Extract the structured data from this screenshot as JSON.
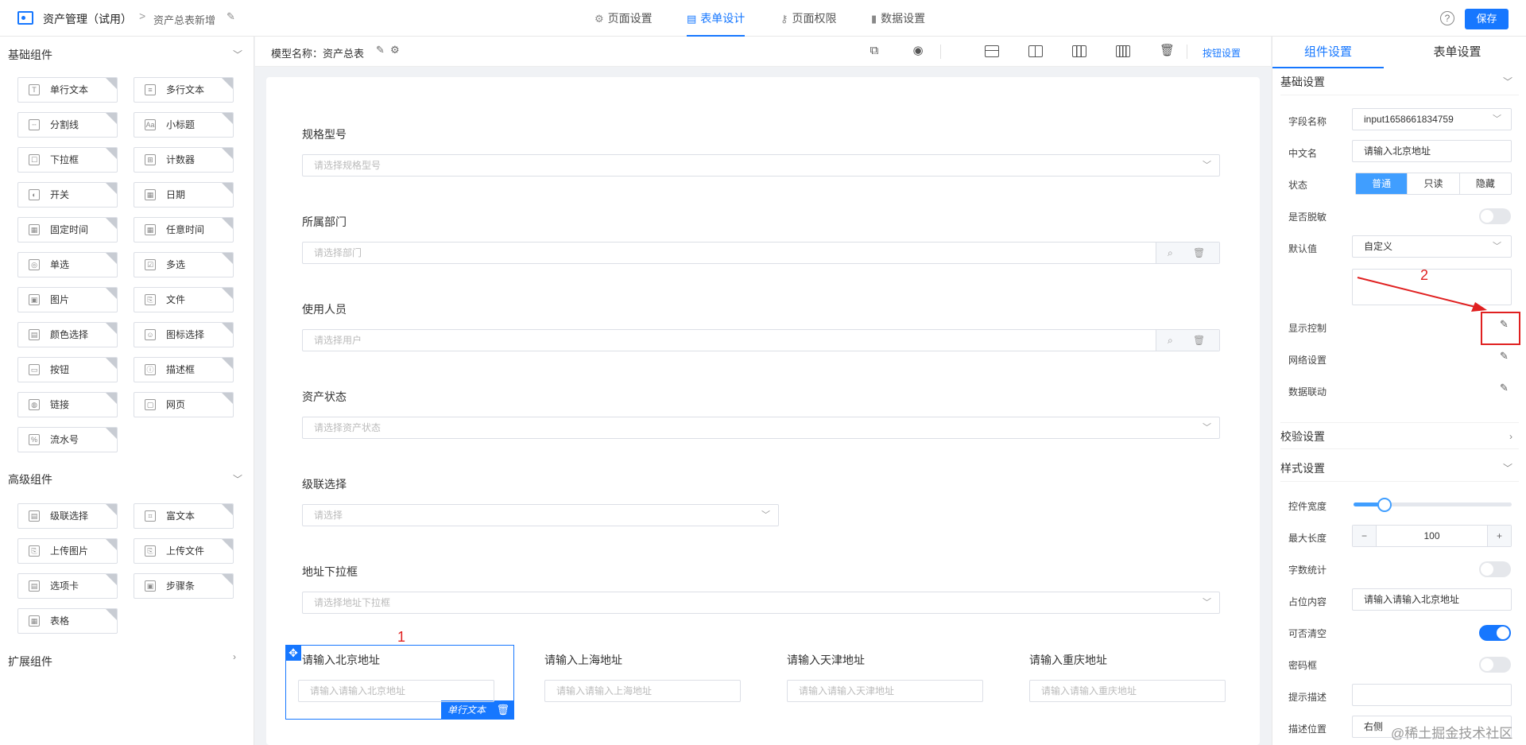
{
  "header": {
    "app_title": "资产管理（试用）",
    "breadcrumb_sep": ">",
    "page_name": "资产总表新增",
    "nav": [
      {
        "label": "页面设置",
        "icon": "gear-icon"
      },
      {
        "label": "表单设计",
        "icon": "document-icon"
      },
      {
        "label": "页面权限",
        "icon": "key-icon"
      },
      {
        "label": "数据设置",
        "icon": "bar-chart-icon"
      }
    ],
    "save_label": "保存"
  },
  "palette": {
    "basic_title": "基础组件",
    "basic_items": [
      "单行文本",
      "多行文本",
      "分割线",
      "小标题",
      "下拉框",
      "计数器",
      "开关",
      "日期",
      "固定时间",
      "任意时间",
      "单选",
      "多选",
      "图片",
      "文件",
      "颜色选择",
      "图标选择",
      "按钮",
      "描述框",
      "链接",
      "网页",
      "流水号"
    ],
    "advanced_title": "高级组件",
    "advanced_items": [
      "级联选择",
      "富文本",
      "上传图片",
      "上传文件",
      "选项卡",
      "步骤条",
      "表格"
    ],
    "extended_title": "扩展组件"
  },
  "toolbar": {
    "model_label": "模型名称：资产总表",
    "button_settings": "按钮设置"
  },
  "form": {
    "fields": [
      {
        "label": "规格型号",
        "placeholder": "请选择规格型号"
      },
      {
        "label": "所属部门",
        "placeholder": "请选择部门"
      },
      {
        "label": "使用人员",
        "placeholder": "请选择用户"
      },
      {
        "label": "资产状态",
        "placeholder": "请选择资产状态"
      },
      {
        "label": "级联选择",
        "placeholder": "请选择"
      },
      {
        "label": "地址下拉框",
        "placeholder": "请选择地址下拉框"
      }
    ],
    "address_row": [
      {
        "label": "请输入北京地址",
        "placeholder": "请输入请输入北京地址"
      },
      {
        "label": "请输入上海地址",
        "placeholder": "请输入请输入上海地址"
      },
      {
        "label": "请输入天津地址",
        "placeholder": "请输入请输入天津地址"
      },
      {
        "label": "请输入重庆地址",
        "placeholder": "请输入请输入重庆地址"
      }
    ],
    "selected_tag": "单行文本",
    "annotation_1": "1"
  },
  "props": {
    "tab_component": "组件设置",
    "tab_form": "表单设置",
    "basic_section": "基础设置",
    "field_name_label": "字段名称",
    "field_name_value": "input1658661834759",
    "cn_name_label": "中文名",
    "cn_name_value": "请输入北京地址",
    "status_label": "状态",
    "status_options": [
      "普通",
      "只读",
      "隐藏"
    ],
    "desensitize_label": "是否脱敏",
    "default_label": "默认值",
    "default_value": "自定义",
    "display_ctrl_label": "显示控制",
    "grid_label": "网络设置",
    "linkage_label": "数据联动",
    "annotation_2": "2",
    "validate_section": "校验设置",
    "style_section": "样式设置",
    "width_label": "控件宽度",
    "width_percent": 17,
    "maxlen_label": "最大长度",
    "maxlen_value": "100",
    "stepper_minus": "−",
    "stepper_plus": "+",
    "wordcount_label": "字数统计",
    "placeholder_label": "占位内容",
    "placeholder_value": "请输入请输入北京地址",
    "clearable_label": "可否清空",
    "password_label": "密码框",
    "hint_label": "提示描述",
    "hint_pos_label": "描述位置",
    "hint_pos_value": "右侧"
  },
  "watermark": "@稀土掘金技术社区"
}
